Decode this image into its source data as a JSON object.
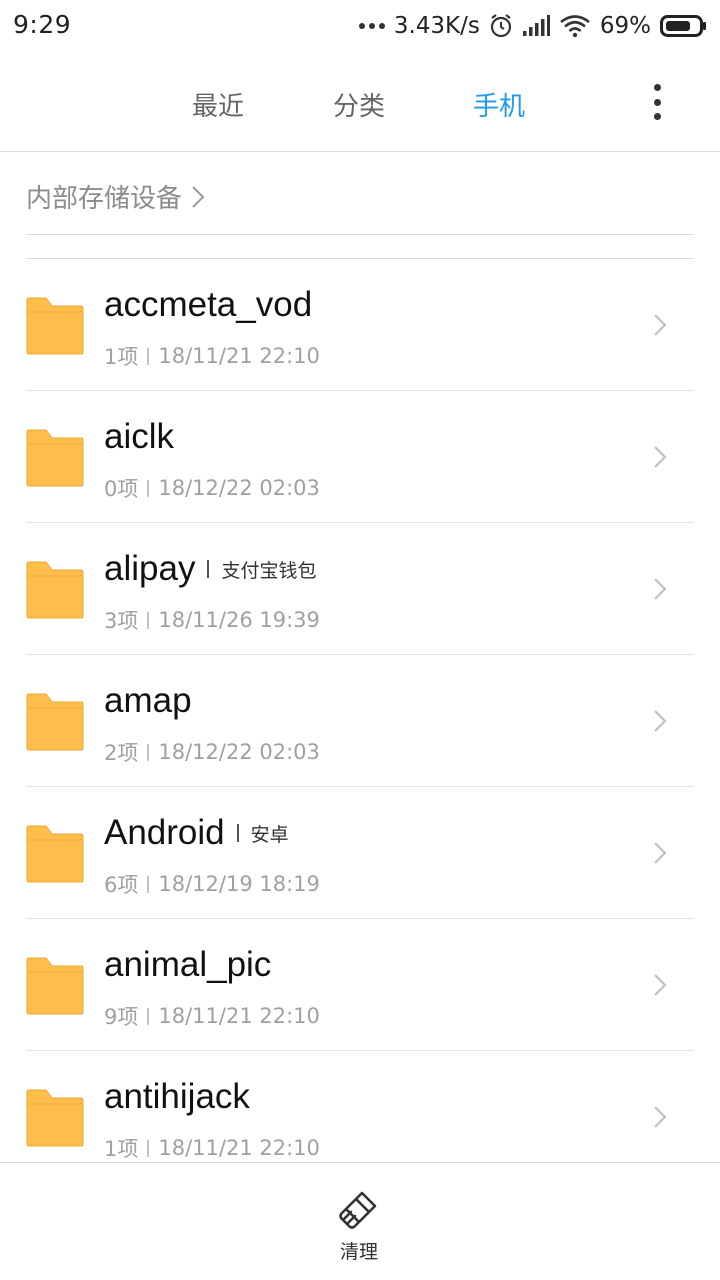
{
  "status_bar": {
    "time": "9:29",
    "network_speed": "3.43K/s",
    "battery": "69%",
    "icons": [
      "more-dots-icon",
      "alarm-icon",
      "signal-icon",
      "wifi-icon",
      "battery-icon"
    ]
  },
  "tabs": [
    {
      "label": "最近",
      "active": false
    },
    {
      "label": "分类",
      "active": false
    },
    {
      "label": "手机",
      "active": true
    }
  ],
  "accent_color": "#1e9bf0",
  "folder_color": "#ffbd4a",
  "breadcrumb": {
    "label": "内部存储设备"
  },
  "files": [
    {
      "name": "accmeta_vod",
      "tag": "",
      "count": "1项",
      "date": "18/11/21 22:10"
    },
    {
      "name": "aiclk",
      "tag": "",
      "count": "0项",
      "date": "18/12/22 02:03"
    },
    {
      "name": "alipay",
      "tag": "支付宝钱包",
      "count": "3项",
      "date": "18/11/26 19:39"
    },
    {
      "name": "amap",
      "tag": "",
      "count": "2项",
      "date": "18/12/22 02:03"
    },
    {
      "name": "Android",
      "tag": "安卓",
      "count": "6项",
      "date": "18/12/19 18:19"
    },
    {
      "name": "animal_pic",
      "tag": "",
      "count": "9项",
      "date": "18/11/21 22:10"
    },
    {
      "name": "antihijack",
      "tag": "",
      "count": "1项",
      "date": "18/11/21 22:10"
    }
  ],
  "bottom_bar": {
    "clean_label": "清理"
  }
}
